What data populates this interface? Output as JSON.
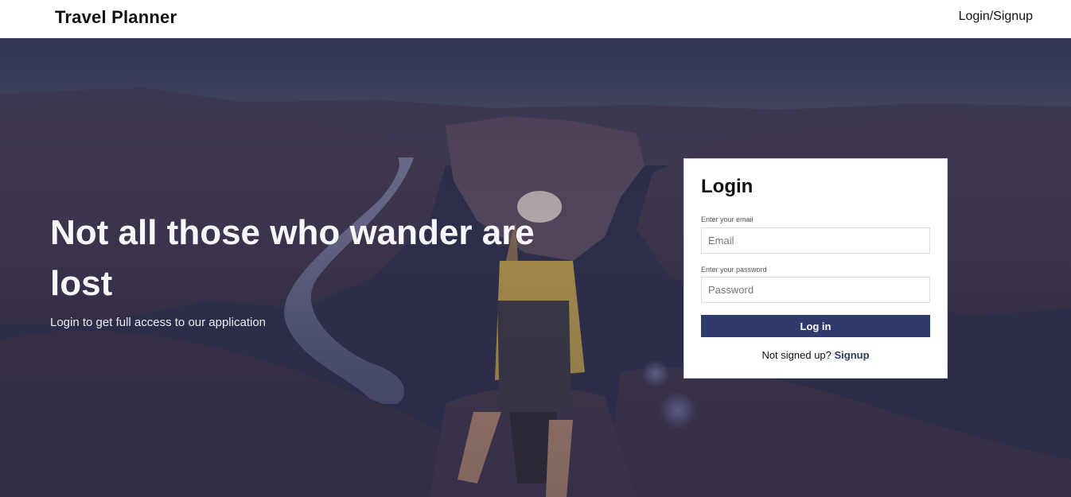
{
  "header": {
    "brand": "Travel Planner",
    "nav_link": "Login/Signup"
  },
  "hero": {
    "headline": "Not all those who wander are lost",
    "subline": "Login to get full access to our application"
  },
  "login": {
    "title": "Login",
    "email_label": "Enter your email",
    "email_placeholder": "Email",
    "email_value": "",
    "password_label": "Enter your password",
    "password_placeholder": "Password",
    "password_value": "",
    "submit_label": "Log in",
    "signup_prompt": "Not signed up?",
    "signup_link": "Signup"
  },
  "colors": {
    "accent": "#2e3b6b",
    "overlay": "#2a2d47",
    "card_bg": "#ffffff"
  }
}
